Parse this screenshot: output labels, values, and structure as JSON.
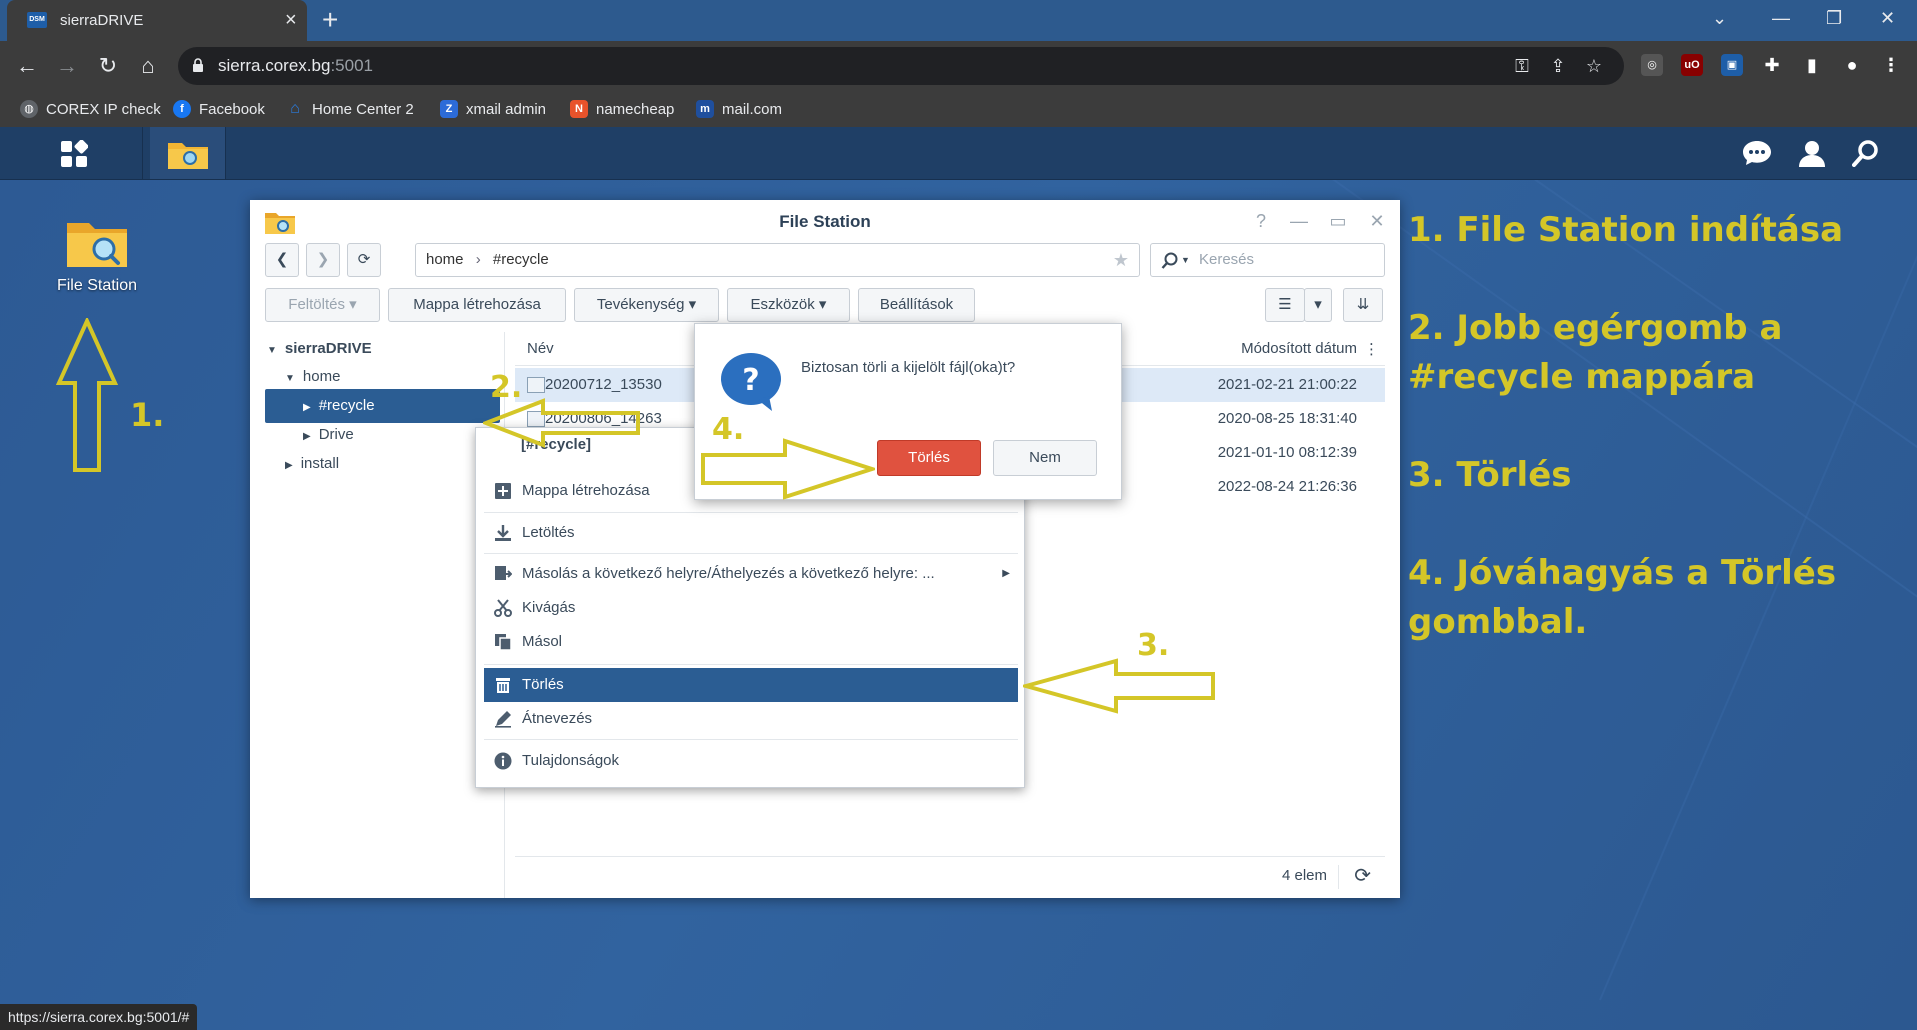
{
  "browser": {
    "tab_title": "sierraDRIVE",
    "tab_favicon": "DSM",
    "url_host": "sierra.corex.bg",
    "url_port": ":5001",
    "status_url": "https://sierra.corex.bg:5001/#",
    "bookmarks": [
      {
        "label": "COREX IP check",
        "icon": "globe-icon",
        "color": "#5f6368"
      },
      {
        "label": "Facebook",
        "icon": "facebook-icon",
        "color": "#1877f2"
      },
      {
        "label": "Home Center 2",
        "icon": "home-icon",
        "color": "#2a7de1"
      },
      {
        "label": "xmail admin",
        "icon": "zimbra-icon",
        "color": "#2c6bd8"
      },
      {
        "label": "namecheap",
        "icon": "namecheap-icon",
        "color": "#e8532b"
      },
      {
        "label": "mail.com",
        "icon": "mailcom-icon",
        "color": "#1f4f9e"
      }
    ]
  },
  "desktop": {
    "icon_label": "File Station",
    "annotations": {
      "arrow1": "1.",
      "arrow2": "2.",
      "arrow3": "3.",
      "arrow4": "4."
    },
    "steps": [
      "1. File Station indítása",
      "2. Jobb egérgomb a #recycle mappára",
      "3. Törlés",
      "4. Jóváhagyás a Törlés gombbal."
    ]
  },
  "window": {
    "title": "File Station",
    "path": [
      "home",
      "#recycle"
    ],
    "search_placeholder": "Keresés",
    "toolbar": {
      "upload": "Feltöltés",
      "create_folder": "Mappa létrehozása",
      "action": "Tevékenység",
      "tools": "Eszközök",
      "settings": "Beállítások"
    },
    "tree": {
      "root": "sierraDRIVE",
      "home": "home",
      "recycle": "#recycle",
      "drive": "Drive",
      "install": "install"
    },
    "columns": {
      "name": "Név",
      "modified": "Módosított dátum"
    },
    "rows": [
      {
        "name": "20200712_13530",
        "date": "2021-02-21 21:00:22"
      },
      {
        "name": "20200806_14263",
        "date": "2020-08-25 18:31:40"
      },
      {
        "name": "",
        "date": "2021-01-10 08:12:39"
      },
      {
        "name": "",
        "date": "2022-08-24 21:26:36"
      }
    ],
    "item_count": "4 elem"
  },
  "context_menu": {
    "header": "[#recycle]",
    "items": {
      "create_folder": "Mappa létrehozása",
      "download": "Letöltés",
      "copy_move": "Másolás a következő helyre/Áthelyezés a következő helyre: ...",
      "cut": "Kivágás",
      "copy": "Másol",
      "delete": "Törlés",
      "rename": "Átnevezés",
      "properties": "Tulajdonságok"
    }
  },
  "dialog": {
    "message": "Biztosan törli a kijelölt fájl(oka)t?",
    "confirm": "Törlés",
    "cancel": "Nem"
  },
  "colors": {
    "annotation": "#d4c628",
    "selection": "#2b5d93",
    "danger": "#e0523f"
  }
}
